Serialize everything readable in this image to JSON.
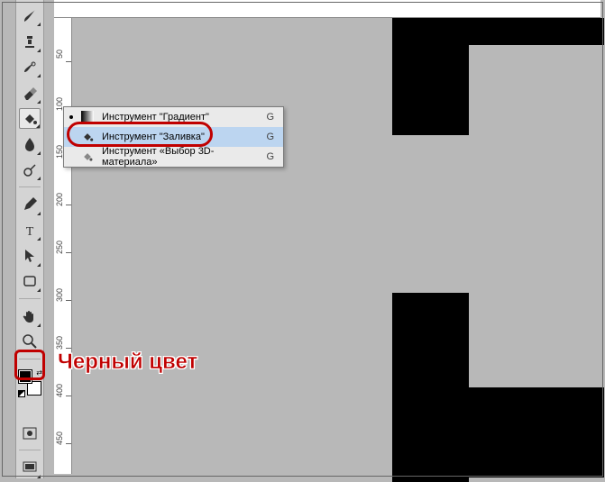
{
  "toolbar": {
    "tools": [
      {
        "name": "brush-tool-icon"
      },
      {
        "name": "stamp-tool-icon"
      },
      {
        "name": "history-brush-icon"
      },
      {
        "name": "eraser-tool-icon"
      },
      {
        "name": "bucket-tool-icon",
        "active": true
      },
      {
        "name": "blur-tool-icon"
      },
      {
        "name": "dodge-tool-icon"
      },
      {
        "name": "pen-tool-icon"
      },
      {
        "name": "type-tool-icon"
      },
      {
        "name": "path-select-icon"
      },
      {
        "name": "shape-tool-icon"
      },
      {
        "name": "hand-tool-icon"
      },
      {
        "name": "zoom-tool-icon"
      }
    ],
    "bottom": [
      {
        "name": "quick-mask-icon"
      },
      {
        "name": "screen-mode-icon"
      }
    ],
    "swatch_fg": "#000000",
    "swatch_bg": "#ffffff"
  },
  "ruler": {
    "ticks": [
      "50",
      "100",
      "150",
      "200",
      "250",
      "300",
      "350",
      "400",
      "450"
    ]
  },
  "flyout": {
    "items": [
      {
        "label": "Инструмент \"Градиент\"",
        "key": "G",
        "selected": false,
        "indicator": true,
        "icon": "gradient-icon"
      },
      {
        "label": "Инструмент \"Заливка\"",
        "key": "G",
        "selected": true,
        "indicator": false,
        "icon": "paint-bucket-icon"
      },
      {
        "label": "Инструмент «Выбор 3D-материала»",
        "key": "G",
        "selected": false,
        "indicator": false,
        "icon": "material-drop-icon"
      }
    ]
  },
  "callouts": {
    "color_label": "Черный цвет"
  },
  "colors": {
    "callout": "#c00000",
    "selection": "#bcd5f0"
  }
}
